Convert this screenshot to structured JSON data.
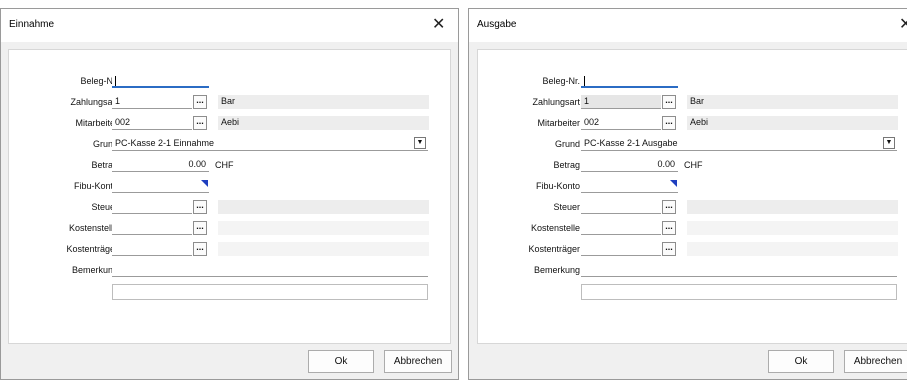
{
  "dialogs": [
    {
      "title": "Einnahme",
      "close": "✕",
      "fields": {
        "beleg_label": "Beleg-Nr.",
        "zahlungsart_label": "Zahlungsart",
        "zahlungsart_value": "1",
        "zahlungsart_desc": "Bar",
        "mitarbeiter_label": "Mitarbeiter",
        "mitarbeiter_value": "002",
        "mitarbeiter_desc": "Aebi",
        "grund_label": "Grund",
        "grund_value": "PC-Kasse 2-1 Einnahme",
        "betrag_label": "Betrag",
        "betrag_value": "0.00",
        "betrag_unit": "CHF",
        "fibu_label": "Fibu-Konto",
        "steuer_label": "Steuer",
        "kostenstelle_label": "Kostenstelle",
        "kostentraeger_label": "Kostenträger",
        "bemerkung_label": "Bemerkung"
      },
      "dots": "...",
      "ok": "Ok",
      "cancel": "Abbrechen"
    },
    {
      "title": "Ausgabe",
      "close": "✕",
      "fields": {
        "beleg_label": "Beleg-Nr.",
        "zahlungsart_label": "Zahlungsart",
        "zahlungsart_value": "1",
        "zahlungsart_desc": "Bar",
        "mitarbeiter_label": "Mitarbeiter",
        "mitarbeiter_value": "002",
        "mitarbeiter_desc": "Aebi",
        "grund_label": "Grund",
        "grund_value": "PC-Kasse 2-1 Ausgabe",
        "betrag_label": "Betrag",
        "betrag_value": "0.00",
        "betrag_unit": "CHF",
        "fibu_label": "Fibu-Konto",
        "steuer_label": "Steuer",
        "kostenstelle_label": "Kostenstelle",
        "kostentraeger_label": "Kostenträger",
        "bemerkung_label": "Bemerkung"
      },
      "dots": "...",
      "ok": "Ok",
      "cancel": "Abbrechen"
    }
  ]
}
